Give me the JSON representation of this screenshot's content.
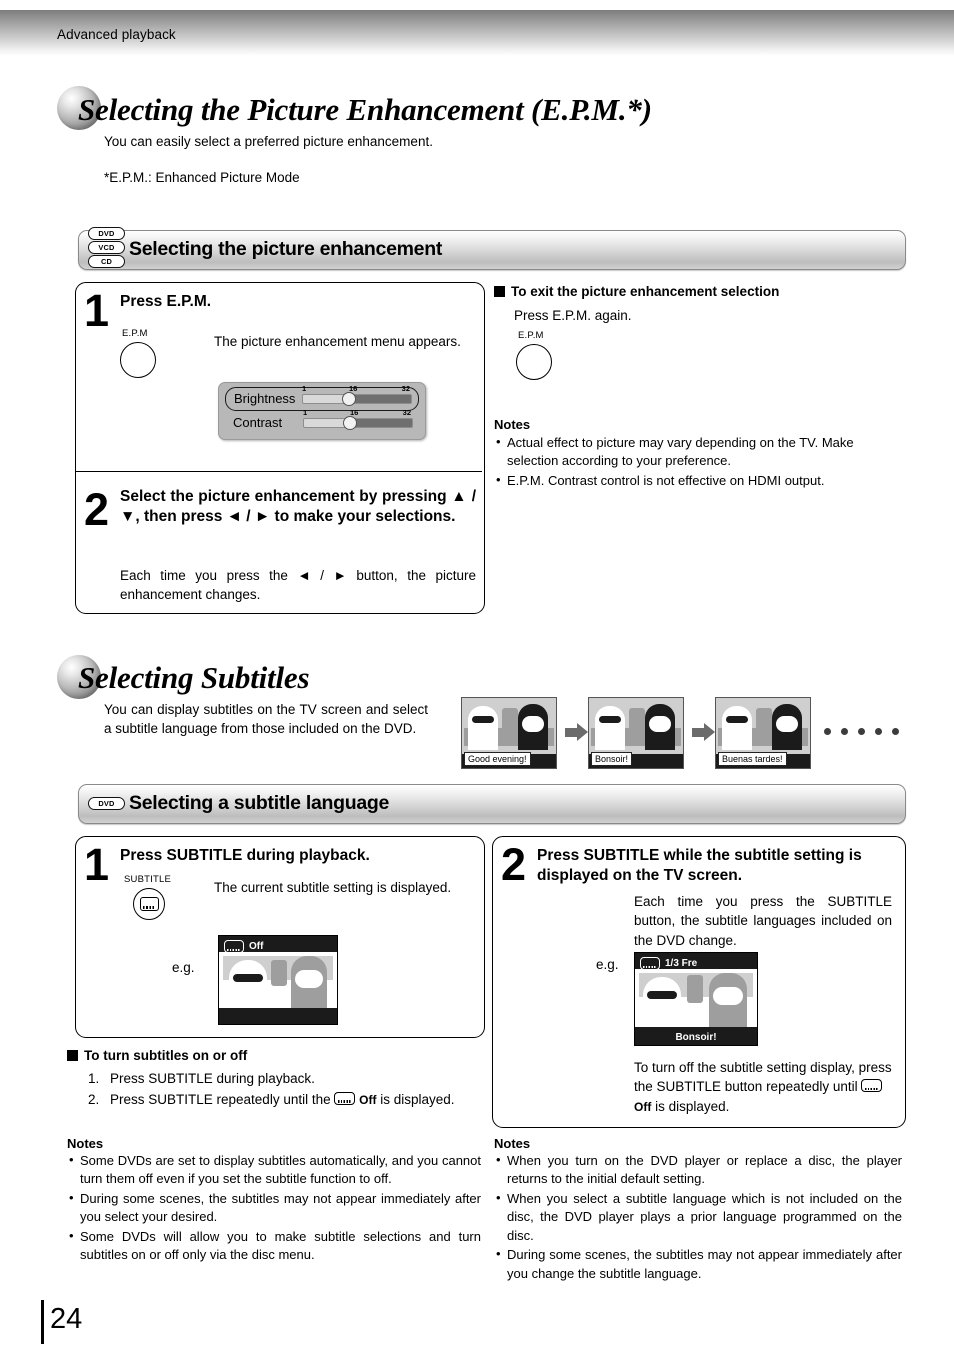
{
  "running_header": {
    "text": "Advanced playback"
  },
  "section1": {
    "title": "Selecting the Picture Enhancement (E.P.M.*)",
    "lead": "You can easily select a preferred picture enhancement.",
    "footnote": "*E.P.M.: Enhanced Picture Mode",
    "bar": {
      "title": "Selecting the picture enhancement",
      "discs": [
        "DVD",
        "VCD",
        "CD"
      ]
    },
    "step1": {
      "number": "1",
      "title": "Press E.P.M.",
      "key_label": "E.P.M",
      "body": "The picture enhancement menu appears.",
      "osd": {
        "rows": [
          {
            "label": "Brightness",
            "selected": true,
            "ticks": [
              "1",
              "16",
              "32"
            ],
            "value": 16
          },
          {
            "label": "Contrast",
            "selected": false,
            "ticks": [
              "1",
              "16",
              "32"
            ],
            "value": 16
          }
        ]
      }
    },
    "step2": {
      "number": "2",
      "title": "Select the picture enhancement by pressing ▲ / ▼, then press ◄ / ► to make your selections.",
      "body": "Each time you press the ◄ / ► button, the picture enhancement changes."
    },
    "exit": {
      "heading": "To exit the picture enhancement selection",
      "body": "Press E.P.M. again.",
      "key_label": "E.P.M"
    },
    "notes": {
      "heading": "Notes",
      "items": [
        "Actual effect to picture may vary depending on the TV.  Make selection according to your preference.",
        "E.P.M. Contrast control is not effective on HDMI output."
      ]
    }
  },
  "section2": {
    "title": "Selecting Subtitles",
    "lead": "You can display subtitles on the TV screen and select a subtitle language from those included on the DVD.",
    "flow": {
      "screens": [
        {
          "caption": "Good evening!"
        },
        {
          "caption": "Bonsoir!"
        },
        {
          "caption": "Buenas tardes!"
        }
      ],
      "trailing_dots": 5
    },
    "bar": {
      "title": "Selecting a subtitle language",
      "discs": [
        "DVD"
      ]
    },
    "step1": {
      "number": "1",
      "title": "Press SUBTITLE during playback.",
      "key_label": "SUBTITLE",
      "key_icon": "subtitle-icon",
      "body": "The current subtitle setting is displayed.",
      "eg_label": "e.g.",
      "screen_osd": "Off"
    },
    "step2": {
      "number": "2",
      "title": "Press SUBTITLE while the subtitle setting is displayed on the TV screen.",
      "body": "Each time you press the SUBTITLE button, the subtitle languages included on the DVD change.",
      "eg_label": "e.g.",
      "screen_osd": "1/3 Fre",
      "screen_caption": "Bonsoir!",
      "body2_a": "To turn off the subtitle setting display, press the SUBTITLE button repeatedly until",
      "body2_off": "Off",
      "body2_b": "is displayed."
    },
    "onoff": {
      "heading": "To turn subtitles on or off",
      "items": [
        {
          "n": "1.",
          "a": "Press SUBTITLE during playback.",
          "b": "",
          "off": ""
        },
        {
          "n": "2.",
          "a": "Press SUBTITLE repeatedly until the",
          "off": "Off",
          "b": "is displayed."
        }
      ]
    },
    "notes_left": {
      "heading": "Notes",
      "items": [
        "Some DVDs are set to display subtitles automatically, and you cannot turn them off even if you set the subtitle function to off.",
        "During some scenes, the subtitles may not appear immediately after you select your desired.",
        "Some DVDs will allow you to make subtitle selections and turn subtitles on or off only via the disc menu."
      ]
    },
    "notes_right": {
      "heading": "Notes",
      "items": [
        "When you turn on the DVD player or replace a disc, the player returns to the initial default setting.",
        "When you select a subtitle language which is not included on the disc, the DVD player plays a prior language programmed on the disc.",
        "During some scenes, the subtitles may not appear immediately after you change the subtitle language."
      ]
    }
  },
  "footer": {
    "page_number": "24"
  },
  "colors": {
    "bar_border": "#8a8a8a",
    "ink": "#000000",
    "osd_bg": "#b8b8b8"
  }
}
